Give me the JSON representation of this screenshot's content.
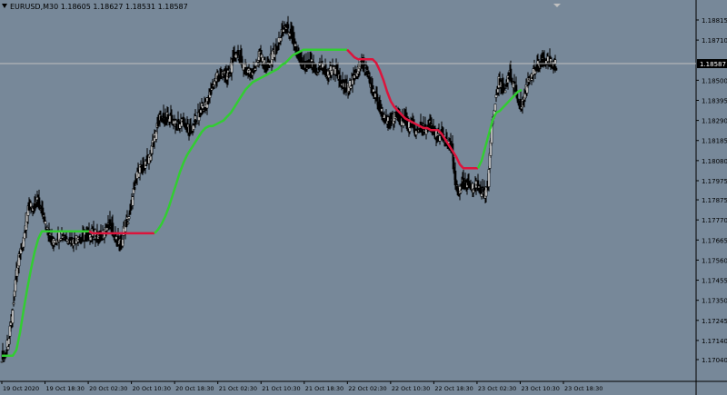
{
  "chart_header": {
    "symbol": "EURUSD,M30",
    "open": "1.18605",
    "high": "1.18627",
    "low": "1.18531",
    "close": "1.18587"
  },
  "colors": {
    "background": "#778899",
    "candles": "#000000",
    "uptrend_line": "#32cd32",
    "downtrend_line": "#dc143c",
    "bid_line": "#c0c0c0",
    "price_tag": "#000000"
  },
  "current_price_label": "1.18587",
  "chart_data": {
    "type": "line",
    "title": "",
    "xlabel": "",
    "ylabel": "",
    "ylim": [
      1.1693,
      1.1851
    ],
    "y_ticks": [
      "1.18815",
      "1.18710",
      "1.18500",
      "1.18395",
      "1.18290",
      "1.18185",
      "1.18080",
      "1.17975",
      "1.17875",
      "1.17770",
      "1.17665",
      "1.17560",
      "1.17455",
      "1.17350",
      "1.17245",
      "1.17140",
      "1.17040"
    ],
    "x_ticks": [
      "19 Oct 2020",
      "19 Oct 18:30",
      "20 Oct 02:30",
      "20 Oct 10:30",
      "20 Oct 18:30",
      "21 Oct 02:30",
      "21 Oct 10:30",
      "21 Oct 18:30",
      "22 Oct 02:30",
      "22 Oct 10:30",
      "22 Oct 18:30",
      "23 Oct 02:30",
      "23 Oct 10:30",
      "23 Oct 18:30"
    ],
    "x": [
      0,
      4,
      8,
      12,
      16,
      20,
      24,
      28,
      32,
      36,
      40,
      44,
      48,
      52,
      56,
      60,
      64,
      68,
      72,
      76,
      80,
      84,
      88,
      92,
      96,
      100,
      104,
      108,
      112,
      116,
      120,
      124,
      128,
      132,
      136,
      140,
      144,
      148,
      152,
      156,
      160,
      164,
      168,
      172,
      176,
      180,
      184,
      188,
      192,
      196,
      200,
      204,
      208,
      212,
      216,
      220,
      224,
      228,
      232,
      236,
      240,
      244,
      248,
      252,
      256,
      260,
      264,
      268,
      272,
      276,
      280,
      284,
      288,
      292,
      296,
      300,
      304,
      308,
      312,
      316,
      320,
      324,
      328,
      332,
      336,
      340,
      344,
      348,
      352,
      356,
      360,
      364,
      368,
      372,
      376,
      380,
      384,
      388,
      392,
      396,
      400,
      404,
      408,
      412,
      416,
      420,
      424,
      428,
      432,
      436,
      440,
      444,
      448,
      452,
      456,
      460,
      464,
      468,
      472,
      476,
      480,
      484,
      488,
      492,
      496,
      500,
      504,
      508,
      512,
      516,
      520,
      524,
      528,
      532,
      536,
      540,
      544,
      548,
      552,
      556,
      560,
      564,
      568,
      572,
      576,
      580,
      584,
      588,
      592,
      596,
      600,
      604,
      608
    ],
    "series": [
      {
        "values": [
          1.1706,
          1.1713,
          1.1725,
          1.1745,
          1.1757,
          1.1765,
          1.1778,
          1.1785,
          1.1782,
          1.1787,
          1.1783,
          1.1777,
          1.177,
          1.1765,
          1.1767,
          1.1769,
          1.1769,
          1.1768,
          1.1767,
          1.1766,
          1.1768,
          1.1767,
          1.1769,
          1.1768,
          1.177,
          1.1769,
          1.1767,
          1.177,
          1.1772,
          1.1775,
          1.177,
          1.1766,
          1.1764,
          1.1773,
          1.1778,
          1.1787,
          1.1797,
          1.1804,
          1.1803,
          1.1808,
          1.181,
          1.1818,
          1.1826,
          1.1832,
          1.1828,
          1.1831,
          1.183,
          1.1827,
          1.1826,
          1.183,
          1.1825,
          1.1823,
          1.1827,
          1.183,
          1.1835,
          1.1836,
          1.184,
          1.1846,
          1.1851,
          1.1852,
          1.1855,
          1.185,
          1.1855,
          1.1862,
          1.1865,
          1.186,
          1.1856,
          1.1855,
          1.1853,
          1.1858,
          1.1863,
          1.186,
          1.1856,
          1.186,
          1.1864,
          1.1867,
          1.1873,
          1.1878,
          1.1876,
          1.1873,
          1.1867,
          1.1861,
          1.1858,
          1.1857,
          1.1859,
          1.1857,
          1.1855,
          1.1858,
          1.1855,
          1.1852,
          1.1856,
          1.1855,
          1.185,
          1.1847,
          1.1846,
          1.1848,
          1.185,
          1.1855,
          1.186,
          1.1856,
          1.1853,
          1.1845,
          1.1842,
          1.1836,
          1.1831,
          1.183,
          1.1826,
          1.1831,
          1.1833,
          1.1828,
          1.183,
          1.1825,
          1.1828,
          1.1823,
          1.1826,
          1.1824,
          1.1825,
          1.1826,
          1.1823,
          1.182,
          1.1822,
          1.1818,
          1.1817,
          1.1814,
          1.1795,
          1.1792,
          1.1796,
          1.1794,
          1.1796,
          1.1793,
          1.1796,
          1.1792,
          1.1791,
          1.1795,
          1.1828,
          1.184,
          1.1849,
          1.1845,
          1.1848,
          1.1853,
          1.1847,
          1.1842,
          1.1836,
          1.1841,
          1.185,
          1.1853,
          1.1855,
          1.1858,
          1.1859,
          1.186,
          1.186,
          1.1858,
          1.1858
        ]
      }
    ],
    "trend_line": [
      {
        "values": [
          1.1706,
          1.1706,
          1.1706,
          1.1706,
          1.1709,
          1.1718,
          1.173,
          1.1741,
          1.1751,
          1.176,
          1.1767,
          1.1771,
          1.1771,
          1.1771,
          1.1771,
          1.1771,
          1.1771,
          1.1771,
          1.1771,
          1.1771,
          1.1771,
          1.1771,
          1.1771,
          1.1771,
          1.1771
        ]
      },
      {
        "values": [
          1.1771,
          1.177,
          1.177,
          1.177,
          1.177,
          1.177,
          1.177,
          1.177,
          1.177,
          1.177,
          1.177,
          1.177,
          1.177,
          1.177,
          1.177,
          1.177,
          1.177,
          1.177,
          1.177
        ]
      },
      {
        "values": [
          1.177,
          1.1772,
          1.1775,
          1.1779,
          1.1784,
          1.179,
          1.1796,
          1.1802,
          1.1807,
          1.1811,
          1.1814,
          1.1817,
          1.182,
          1.1823,
          1.1825,
          1.1826,
          1.1826,
          1.1827,
          1.1828,
          1.1829,
          1.1831,
          1.1833,
          1.1836,
          1.1839,
          1.1842,
          1.1845,
          1.1847,
          1.1849,
          1.185,
          1.1851,
          1.1852,
          1.1853,
          1.1854,
          1.1855,
          1.1856,
          1.1858,
          1.1859,
          1.1861,
          1.1863,
          1.1864,
          1.1865,
          1.1866,
          1.1866,
          1.1866,
          1.1866,
          1.1866,
          1.1866,
          1.1866,
          1.1866,
          1.1866,
          1.1866,
          1.1866,
          1.1866,
          1.1866
        ]
      },
      {
        "values": [
          1.1866,
          1.1864,
          1.1862,
          1.1861,
          1.1861,
          1.1861,
          1.1861,
          1.1861,
          1.1859,
          1.1855,
          1.185,
          1.1844,
          1.1839,
          1.1836,
          1.1834,
          1.1832,
          1.183,
          1.1829,
          1.1828,
          1.1827,
          1.1826,
          1.1825,
          1.1825,
          1.1824,
          1.1824,
          1.1824,
          1.1822,
          1.1819,
          1.1816,
          1.1813,
          1.181,
          1.1806,
          1.1804,
          1.1804,
          1.1804,
          1.1804,
          1.1804
        ]
      },
      {
        "values": [
          1.1804,
          1.1808,
          1.1815,
          1.1822,
          1.1829,
          1.1833,
          1.1834,
          1.1836,
          1.1838,
          1.184,
          1.1842,
          1.1844,
          1.1845
        ]
      }
    ],
    "current_price": 1.18587
  }
}
